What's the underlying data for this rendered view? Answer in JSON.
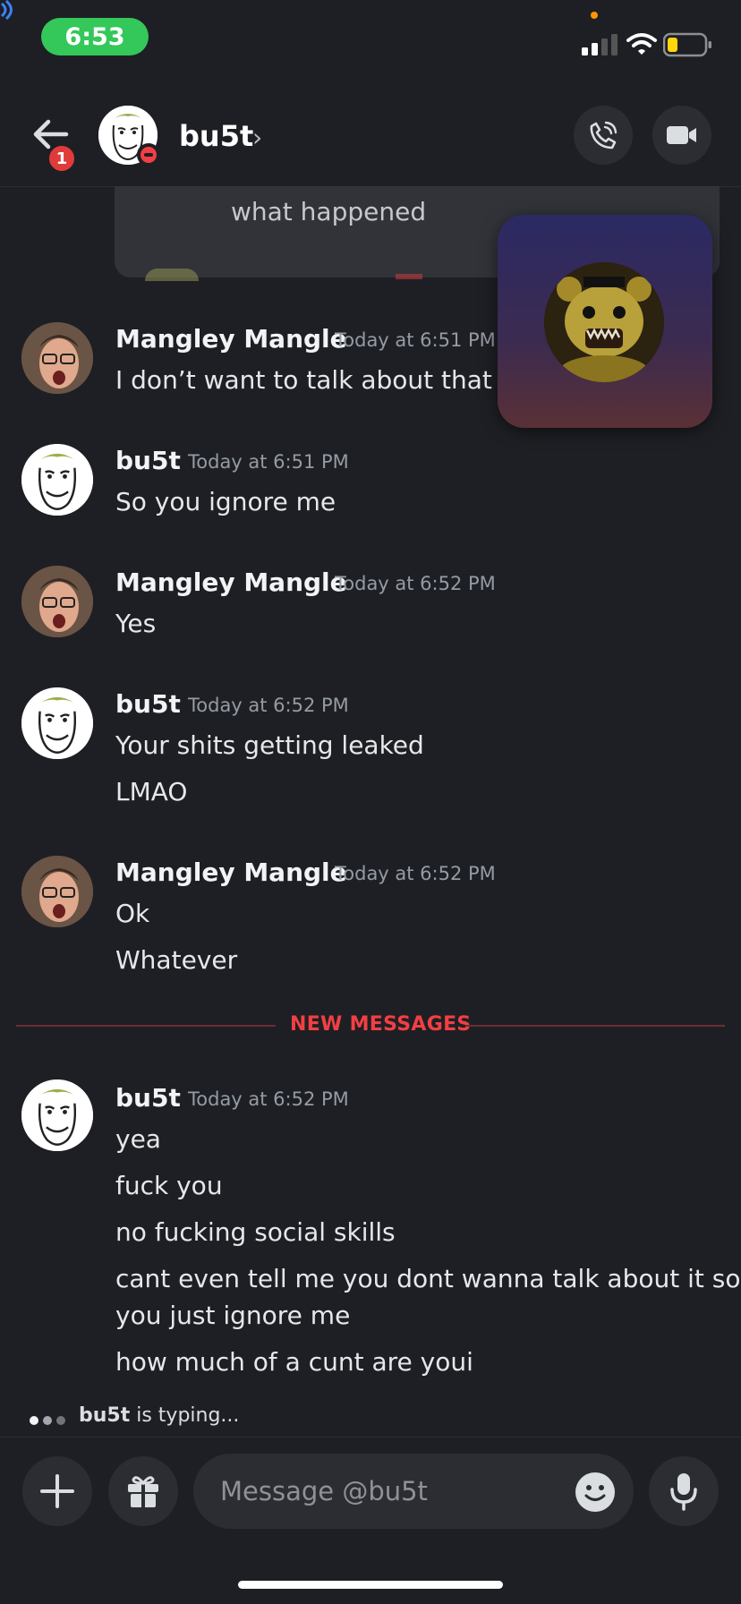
{
  "status_bar": {
    "time": "6:53",
    "icons": [
      "carplay-icon",
      "signal-icon",
      "wifi-icon",
      "battery-icon"
    ],
    "pill_color": "#34c759"
  },
  "header": {
    "back_badge": "1",
    "username": "bu5t",
    "chevron": "›",
    "icons": [
      "back-arrow-icon",
      "phone-call-icon",
      "video-camera-icon"
    ],
    "status": "do-not-disturb"
  },
  "quoted": {
    "text": "what happened"
  },
  "messages": [
    {
      "author": "Mangley Mangle",
      "timestamp": "Today at 6:51 PM",
      "avatar": "photo",
      "lines": [
        "I don’t want to talk about that"
      ]
    },
    {
      "author": "bu5t",
      "timestamp": "Today at 6:51 PM",
      "avatar": "meme",
      "lines": [
        "So you ignore me"
      ]
    },
    {
      "author": "Mangley Mangle",
      "timestamp": "Today at 6:52 PM",
      "avatar": "photo",
      "lines": [
        "Yes"
      ]
    },
    {
      "author": "bu5t",
      "timestamp": "Today at 6:52 PM",
      "avatar": "meme",
      "lines": [
        "Your shits getting leaked",
        "LMAO"
      ]
    },
    {
      "author": "Mangley Mangle",
      "timestamp": "Today at 6:52 PM",
      "avatar": "photo",
      "lines": [
        "Ok",
        "Whatever"
      ]
    },
    {
      "author": "bu5t",
      "timestamp": "Today at 6:52 PM",
      "avatar": "meme",
      "lines": [
        "yea",
        "fuck you",
        "no fucking social skills",
        "cant even tell me you dont wanna talk about it so",
        "you just ignore me",
        "how much of a cunt are youi"
      ]
    }
  ],
  "divider": {
    "label": "NEW MESSAGES",
    "color": "#f23f43"
  },
  "typing": {
    "user": "bu5t",
    "suffix": " is typing..."
  },
  "composer": {
    "placeholder": "Message @bu5t",
    "icons": [
      "plus-icon",
      "gift-icon",
      "emoji-icon",
      "microphone-icon"
    ]
  },
  "colors": {
    "background": "#1e1f24",
    "surface": "#2b2d33",
    "accent_red": "#f23f43"
  }
}
